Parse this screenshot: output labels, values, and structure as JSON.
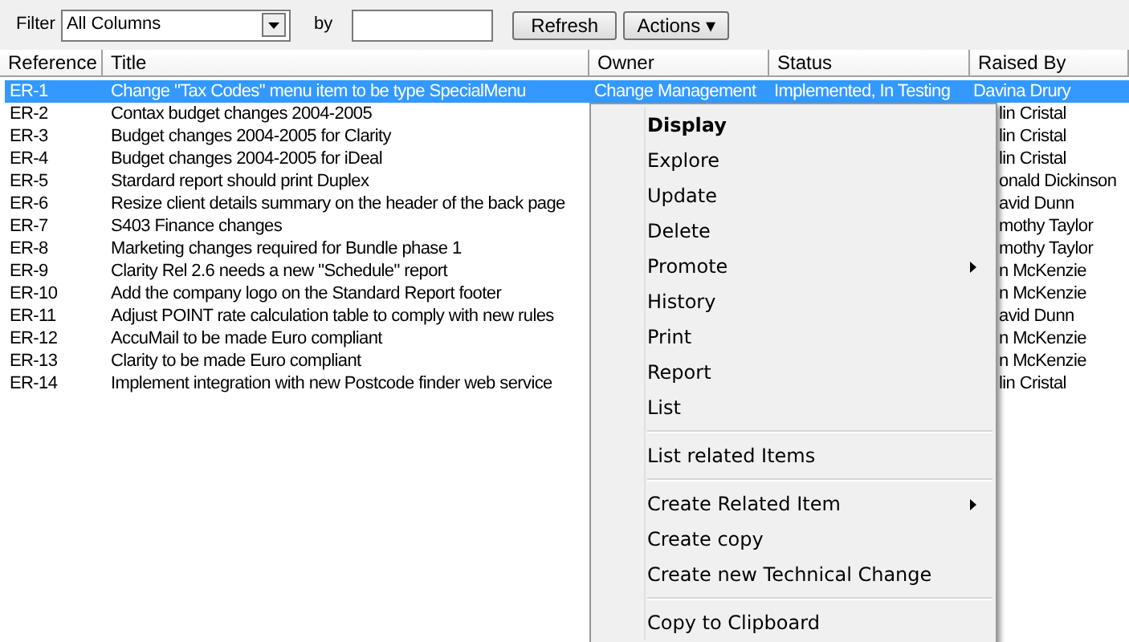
{
  "toolbar": {
    "filter_label": "Filter",
    "filter_value": "All Columns",
    "by_label": "by",
    "refresh": "Refresh",
    "actions": "Actions ▾"
  },
  "table": {
    "columns": [
      "Reference",
      "Title",
      "Owner",
      "Status",
      "Raised By"
    ],
    "rows": [
      {
        "reference": "ER-1",
        "title": "Change \"Tax Codes\" menu item to be type SpecialMenu",
        "owner": "Change Management",
        "status": "Implemented, In Testing",
        "raised_by": "Davina Drury",
        "selected": true
      },
      {
        "reference": "ER-2",
        "title": "Contax budget changes 2004-2005",
        "raised_by": "lin Cristal",
        "selected": false
      },
      {
        "reference": "ER-3",
        "title": "Budget changes 2004-2005 for Clarity",
        "raised_by": "lin Cristal",
        "selected": false
      },
      {
        "reference": "ER-4",
        "title": "Budget changes 2004-2005 for iDeal",
        "raised_by": "lin Cristal",
        "selected": false
      },
      {
        "reference": "ER-5",
        "title": "Stardard report should print Duplex",
        "raised_by": "onald Dickinson",
        "selected": false
      },
      {
        "reference": "ER-6",
        "title": "Resize client details summary on the header of the back page",
        "raised_by": "avid Dunn",
        "selected": false
      },
      {
        "reference": "ER-7",
        "title": "S403 Finance changes",
        "raised_by": "mothy Taylor",
        "selected": false
      },
      {
        "reference": "ER-8",
        "title": "Marketing changes required for Bundle phase 1",
        "raised_by": "mothy Taylor",
        "selected": false
      },
      {
        "reference": "ER-9",
        "title": "Clarity Rel 2.6 needs a new \"Schedule\" report",
        "raised_by": "n McKenzie",
        "selected": false
      },
      {
        "reference": "ER-10",
        "title": "Add the company logo on the Standard Report footer",
        "raised_by": "n McKenzie",
        "selected": false
      },
      {
        "reference": "ER-11",
        "title": "Adjust POINT rate calculation table to comply with new rules",
        "raised_by": "avid Dunn",
        "selected": false
      },
      {
        "reference": "ER-12",
        "title": "AccuMail to be made Euro compliant",
        "raised_by": "n McKenzie",
        "selected": false
      },
      {
        "reference": "ER-13",
        "title": "Clarity to be made Euro compliant",
        "raised_by": "n McKenzie",
        "selected": false
      },
      {
        "reference": "ER-14",
        "title": "Implement integration with new Postcode finder web service",
        "raised_by": "lin Cristal",
        "selected": false
      }
    ]
  },
  "context_menu": [
    {
      "kind": "item",
      "label": "Display",
      "default": true,
      "submenu": false
    },
    {
      "kind": "item",
      "label": "Explore",
      "default": false,
      "submenu": false
    },
    {
      "kind": "item",
      "label": "Update",
      "default": false,
      "submenu": false
    },
    {
      "kind": "item",
      "label": "Delete",
      "default": false,
      "submenu": false
    },
    {
      "kind": "item",
      "label": "Promote",
      "default": false,
      "submenu": true
    },
    {
      "kind": "item",
      "label": "History",
      "default": false,
      "submenu": false
    },
    {
      "kind": "item",
      "label": "Print",
      "default": false,
      "submenu": false
    },
    {
      "kind": "item",
      "label": "Report",
      "default": false,
      "submenu": false
    },
    {
      "kind": "item",
      "label": "List",
      "default": false,
      "submenu": false
    },
    {
      "kind": "separator"
    },
    {
      "kind": "item",
      "label": "List related Items",
      "default": false,
      "submenu": false
    },
    {
      "kind": "separator"
    },
    {
      "kind": "item",
      "label": "Create Related Item",
      "default": false,
      "submenu": true
    },
    {
      "kind": "item",
      "label": "Create copy",
      "default": false,
      "submenu": false
    },
    {
      "kind": "item",
      "label": "Create new Technical Change",
      "default": false,
      "submenu": false
    },
    {
      "kind": "separator"
    },
    {
      "kind": "item",
      "label": "Copy to Clipboard",
      "default": false,
      "submenu": false
    }
  ]
}
